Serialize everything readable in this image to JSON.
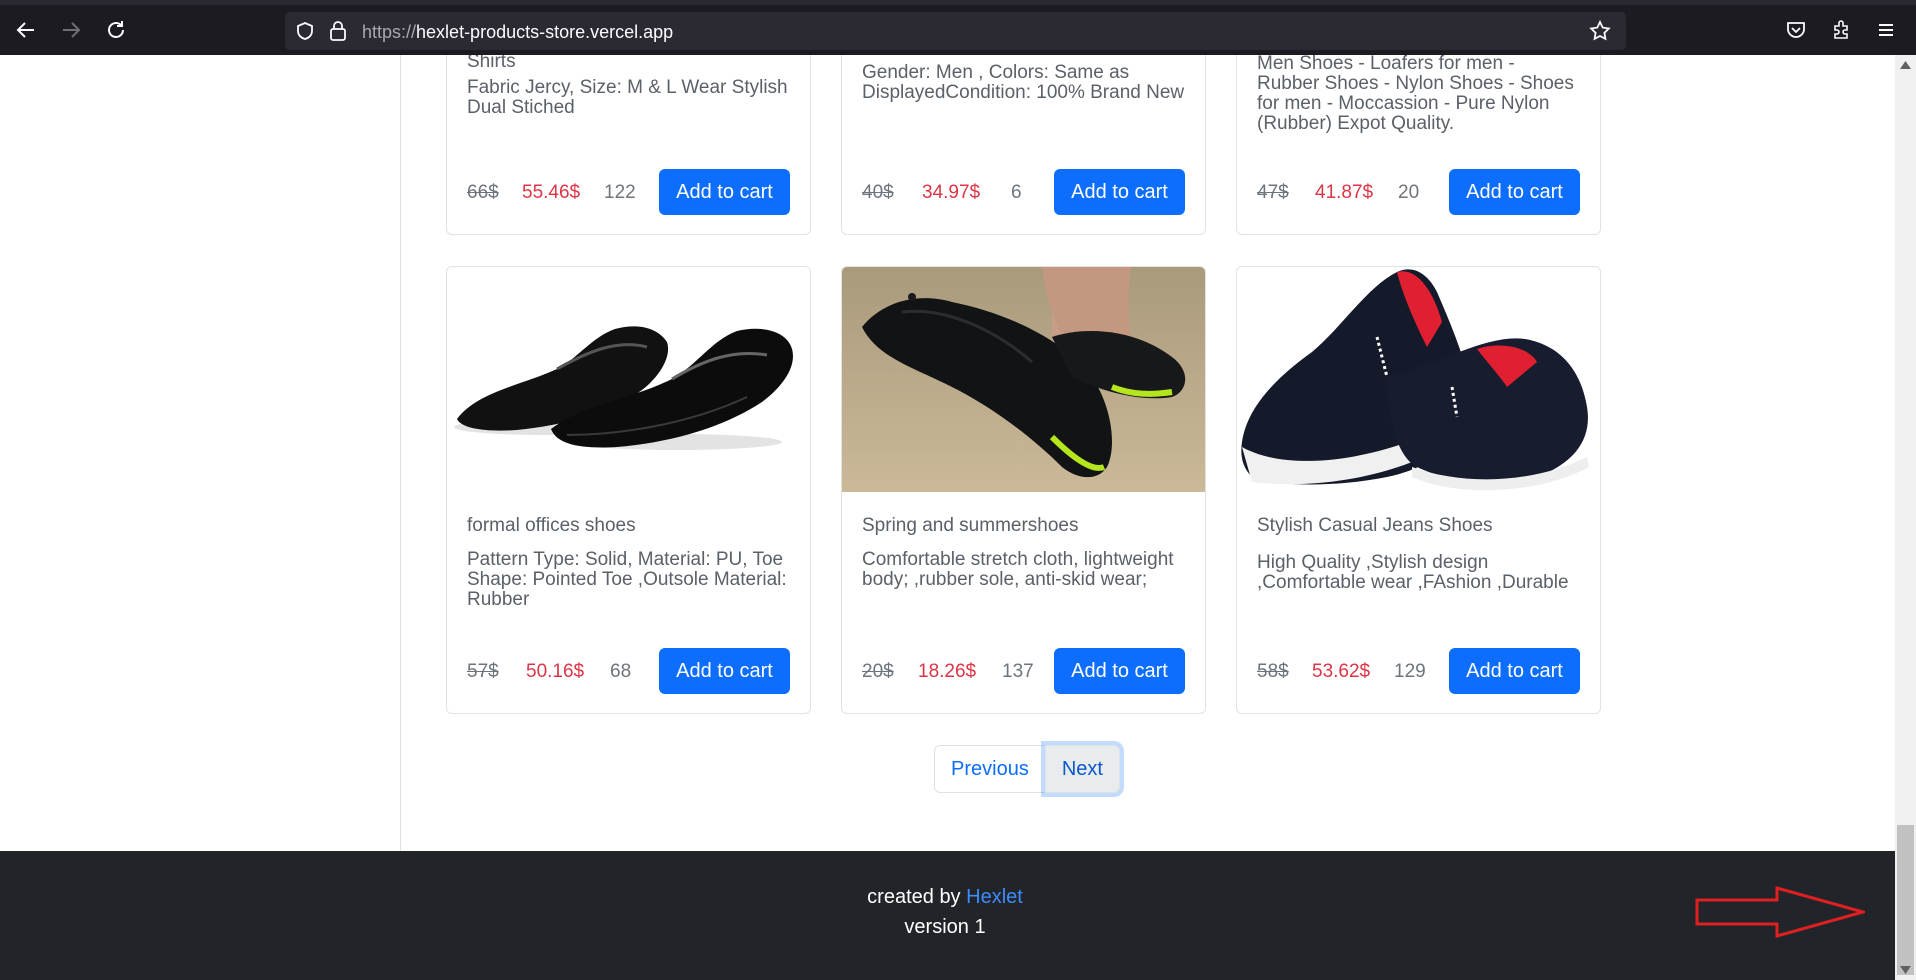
{
  "browser": {
    "url_scheme": "https://",
    "url_host": "hexlet-products-store.vercel.app"
  },
  "top_row": [
    {
      "title_cut": "Shirts",
      "description": "Fabric Jercy, Size: M & L Wear Stylish Dual Stiched",
      "old_price": "66$",
      "new_price": "55.46$",
      "quantity": "122",
      "button": "Add to cart"
    },
    {
      "description": "Gender: Men , Colors: Same as DisplayedCondition: 100% Brand New",
      "old_price": "40$",
      "new_price": "34.97$",
      "quantity": "6",
      "button": "Add to cart"
    },
    {
      "description": "Men Shoes - Loafers for men - Rubber Shoes - Nylon Shoes - Shoes for men - Moccassion - Pure Nylon (Rubber) Expot Quality.",
      "old_price": "47$",
      "new_price": "41.87$",
      "quantity": "20",
      "button": "Add to cart"
    }
  ],
  "products": [
    {
      "title": "formal offices shoes",
      "description": "Pattern Type: Solid, Material: PU, Toe Shape: Pointed Toe ,Outsole Material: Rubber",
      "old_price": "57$",
      "new_price": "50.16$",
      "quantity": "68",
      "button": "Add to cart"
    },
    {
      "title": "Spring and summershoes",
      "description": "Comfortable stretch cloth, lightweight body; ,rubber sole, anti-skid wear;",
      "old_price": "20$",
      "new_price": "18.26$",
      "quantity": "137",
      "button": "Add to cart"
    },
    {
      "title": "Stylish Casual Jeans Shoes",
      "description": "High Quality ,Stylish design ,Comfortable wear ,FAshion ,Durable",
      "old_price": "58$",
      "new_price": "53.62$",
      "quantity": "129",
      "button": "Add to cart"
    }
  ],
  "pagination": {
    "previous": "Previous",
    "next": "Next"
  },
  "footer": {
    "created_by": "created by",
    "author_link": "Hexlet",
    "version": "version 1"
  },
  "colors": {
    "primary": "#0d6efd",
    "danger": "#dc3545",
    "footer_bg": "#212529",
    "annotation": "#e02020"
  },
  "icons": [
    "back-arrow-icon",
    "forward-arrow-icon",
    "reload-icon",
    "shield-icon",
    "lock-icon",
    "bookmark-star-icon",
    "pocket-icon",
    "extensions-icon",
    "menu-icon"
  ]
}
